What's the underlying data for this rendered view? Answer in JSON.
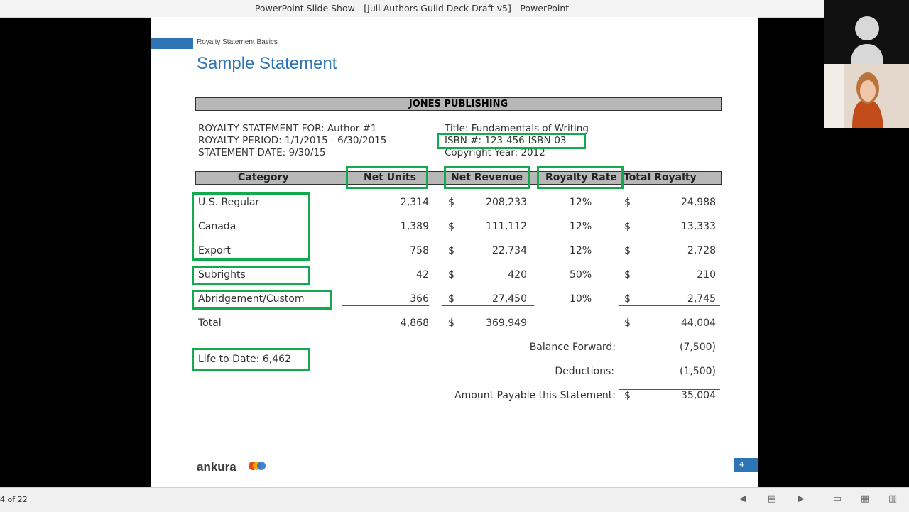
{
  "window": {
    "title": "PowerPoint Slide Show - [Juli Authors Guild Deck Draft v5] - PowerPoint"
  },
  "slide": {
    "section": "Royalty Statement Basics",
    "title": "Sample Statement",
    "publisher": "JONES PUBLISHING",
    "info_left": [
      "ROYALTY STATEMENT FOR: Author #1",
      "ROYALTY PERIOD: 1/1/2015 - 6/30/2015",
      "STATEMENT DATE: 9/30/15"
    ],
    "info_right": [
      "Title: Fundamentals of Writing",
      "ISBN #: 123-456-ISBN-03",
      "Copyright Year: 2012"
    ],
    "columns": [
      "Category",
      "Net Units",
      "Net Revenue",
      "Royalty Rate",
      "Total Royalty"
    ],
    "rows": [
      {
        "category": "U.S. Regular",
        "units": "2,314",
        "cur1": "$",
        "revenue": "208,233",
        "rate": "12%",
        "cur2": "$",
        "royalty": "24,988"
      },
      {
        "category": "Canada",
        "units": "1,389",
        "cur1": "$",
        "revenue": "111,112",
        "rate": "12%",
        "cur2": "$",
        "royalty": "13,333"
      },
      {
        "category": "Export",
        "units": "758",
        "cur1": "$",
        "revenue": "22,734",
        "rate": "12%",
        "cur2": "$",
        "royalty": "2,728"
      },
      {
        "category": "Subrights",
        "units": "42",
        "cur1": "$",
        "revenue": "420",
        "rate": "50%",
        "cur2": "$",
        "royalty": "210"
      },
      {
        "category": "Abridgement/Custom",
        "units": "366",
        "cur1": "$",
        "revenue": "27,450",
        "rate": "10%",
        "cur2": "$",
        "royalty": "2,745"
      }
    ],
    "total": {
      "label": "Total",
      "units": "4,868",
      "cur1": "$",
      "revenue": "369,949",
      "cur2": "$",
      "royalty": "44,004"
    },
    "balance_forward": {
      "label": "Balance Forward:",
      "value": "(7,500)"
    },
    "deductions": {
      "label": "Deductions:",
      "value": "(1,500)"
    },
    "payable": {
      "label": "Amount Payable this Statement:",
      "cur": "$",
      "value": "35,004"
    },
    "life_to_date": "Life to Date: 6,462",
    "logo": "ankura",
    "page_number": "4",
    "highlight_color": "#12a94f",
    "accent_color": "#2e75b6"
  },
  "status": {
    "slide_count": "4 of 22"
  },
  "icons": [
    "previous-icon",
    "slide-sorter-icon",
    "next-icon",
    "normal-view-icon",
    "grid-view-icon",
    "reading-view-icon",
    "person-icon"
  ]
}
